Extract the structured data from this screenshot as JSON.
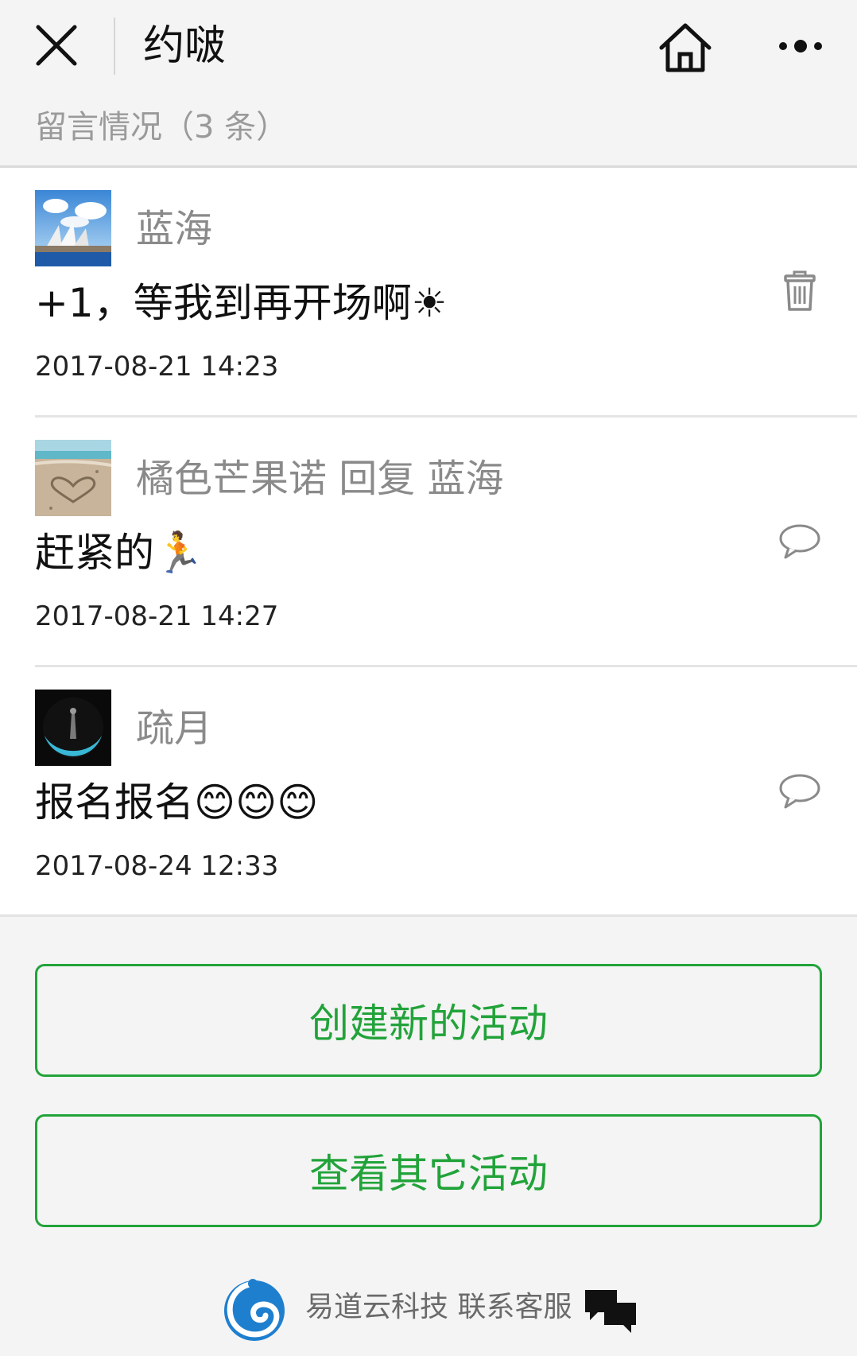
{
  "nav": {
    "title": "约啵",
    "close_icon": "close-icon",
    "home_icon": "home-icon",
    "more_icon": "more-icon"
  },
  "section": {
    "title": "留言情况（3 条）"
  },
  "comments": [
    {
      "author": "蓝海",
      "text": "+1，等我到再开场啊☀",
      "time": "2017-08-21 14:23",
      "action_icon": "trash-icon",
      "avatar": "opera-house-photo"
    },
    {
      "author": "橘色芒果诺 回复 蓝海",
      "text": "赶紧的🏃",
      "time": "2017-08-21 14:27",
      "action_icon": "reply-bubble-icon",
      "avatar": "beach-heart-photo"
    },
    {
      "author": "疏月",
      "text": "报名报名😊😊😊",
      "time": "2017-08-24 12:33",
      "action_icon": "reply-bubble-icon",
      "avatar": "moon-night-photo"
    }
  ],
  "buttons": {
    "create": "创建新的活动",
    "view_others": "查看其它活动"
  },
  "footer": {
    "text": "易道云科技 联系客服",
    "logo_icon": "yidaoyun-logo-icon",
    "chat_icon": "chat-bubbles-icon"
  },
  "colors": {
    "accent_green": "#22a33a",
    "background": "#f4f4f4",
    "muted_text": "#8a8a8a"
  }
}
